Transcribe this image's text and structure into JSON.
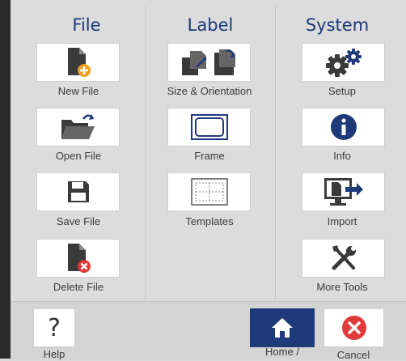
{
  "columns": {
    "file": {
      "title": "File",
      "items": [
        {
          "label": "New File",
          "icon": "new-file-icon"
        },
        {
          "label": "Open File",
          "icon": "open-file-icon"
        },
        {
          "label": "Save File",
          "icon": "save-file-icon"
        },
        {
          "label": "Delete File",
          "icon": "delete-file-icon"
        }
      ]
    },
    "label": {
      "title": "Label",
      "items": [
        {
          "label": "Size & Orientation",
          "icon": "size-orientation-icon"
        },
        {
          "label": "Frame",
          "icon": "frame-icon"
        },
        {
          "label": "Templates",
          "icon": "templates-icon"
        }
      ]
    },
    "system": {
      "title": "System",
      "items": [
        {
          "label": "Setup",
          "icon": "gear-icon"
        },
        {
          "label": "Info",
          "icon": "info-icon"
        },
        {
          "label": "Import",
          "icon": "import-icon"
        },
        {
          "label": "More Tools",
          "icon": "tools-icon"
        }
      ]
    }
  },
  "bottom": {
    "help_label": "Help",
    "help_glyph": "?",
    "home_label": "Home /",
    "cancel_label": "Cancel"
  },
  "colors": {
    "title_blue": "#1a3a7a",
    "home_bg": "#1f3a7a",
    "cancel_red": "#e03a3a",
    "accent_orange": "#f0a020",
    "icon_dark": "#3a3a3a"
  }
}
